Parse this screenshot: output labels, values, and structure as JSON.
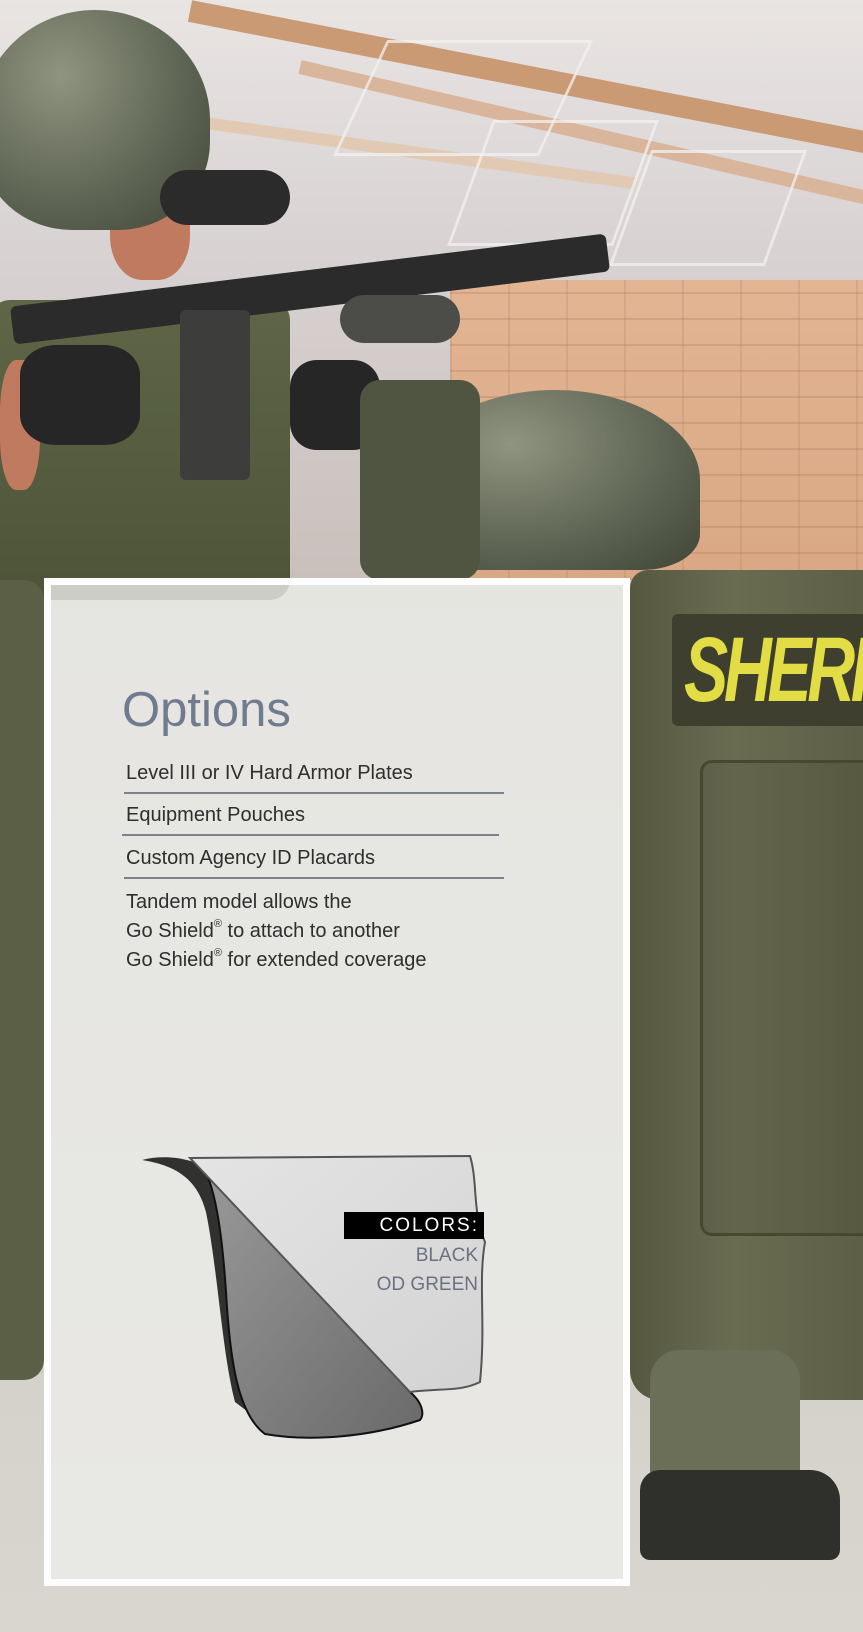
{
  "options": {
    "title": "Options",
    "items": [
      "Level III or IV Hard Armor Plates",
      "Equipment Pouches",
      "Custom Agency ID Placards"
    ],
    "tandem": {
      "line1": "Tandem model allows the",
      "line2_pre": "Go Shield",
      "line2_post": " to attach to another",
      "line3_pre": "Go Shield",
      "line3_post": " for extended coverage",
      "registered_mark": "®"
    }
  },
  "colors": {
    "label": "COLORS:",
    "items": [
      "BLACK",
      "OD GREEN"
    ]
  },
  "photo": {
    "patch_text": "SHERIFF",
    "patch_text_color": "#e2dd45"
  },
  "theme": {
    "title_color": "#6f7b8f",
    "text_color": "#2e2e2e",
    "color_item_color": "#6b7181"
  }
}
